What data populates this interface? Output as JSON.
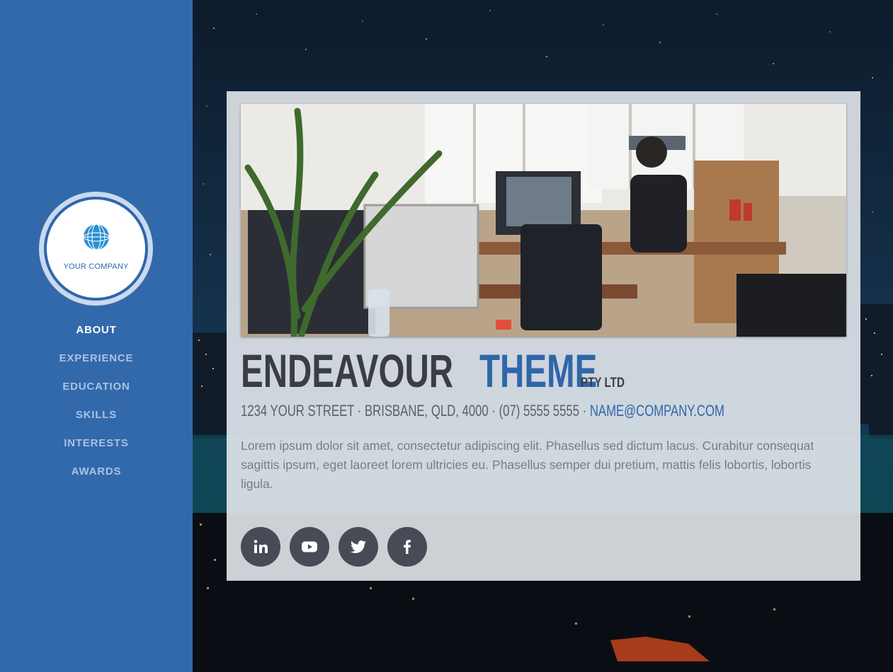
{
  "logo": {
    "text": "YOUR COMPANY",
    "icon": "globe-logo-icon"
  },
  "nav": [
    {
      "label": "ABOUT",
      "active": true
    },
    {
      "label": "EXPERIENCE",
      "active": false
    },
    {
      "label": "EDUCATION",
      "active": false
    },
    {
      "label": "SKILLS",
      "active": false
    },
    {
      "label": "INTERESTS",
      "active": false
    },
    {
      "label": "AWARDS",
      "active": false
    }
  ],
  "header": {
    "name_first": "ENDEAVOUR",
    "name_second": "THEME",
    "suffix": "PTY LTD",
    "address": "1234 YOUR STREET · BRISBANE, QLD, 4000 · (07) 5555 5555 ·",
    "email": "NAME@COMPANY.COM"
  },
  "lead": "Lorem ipsum dolor sit amet, consectetur adipiscing elit. Phasellus sed dictum lacus. Curabitur consequat sagittis ipsum, eget laoreet lorem ultricies eu. Phasellus semper dui pretium, mattis felis lobortis, lobortis ligula.",
  "social": [
    {
      "icon": "linkedin-icon"
    },
    {
      "icon": "youtube-icon"
    },
    {
      "icon": "twitter-icon"
    },
    {
      "icon": "facebook-icon"
    }
  ],
  "colors": {
    "sidebar": "#3269ab",
    "accent": "#2f66aa",
    "dark_text": "#3a3d44",
    "social_bg": "#474b55"
  }
}
